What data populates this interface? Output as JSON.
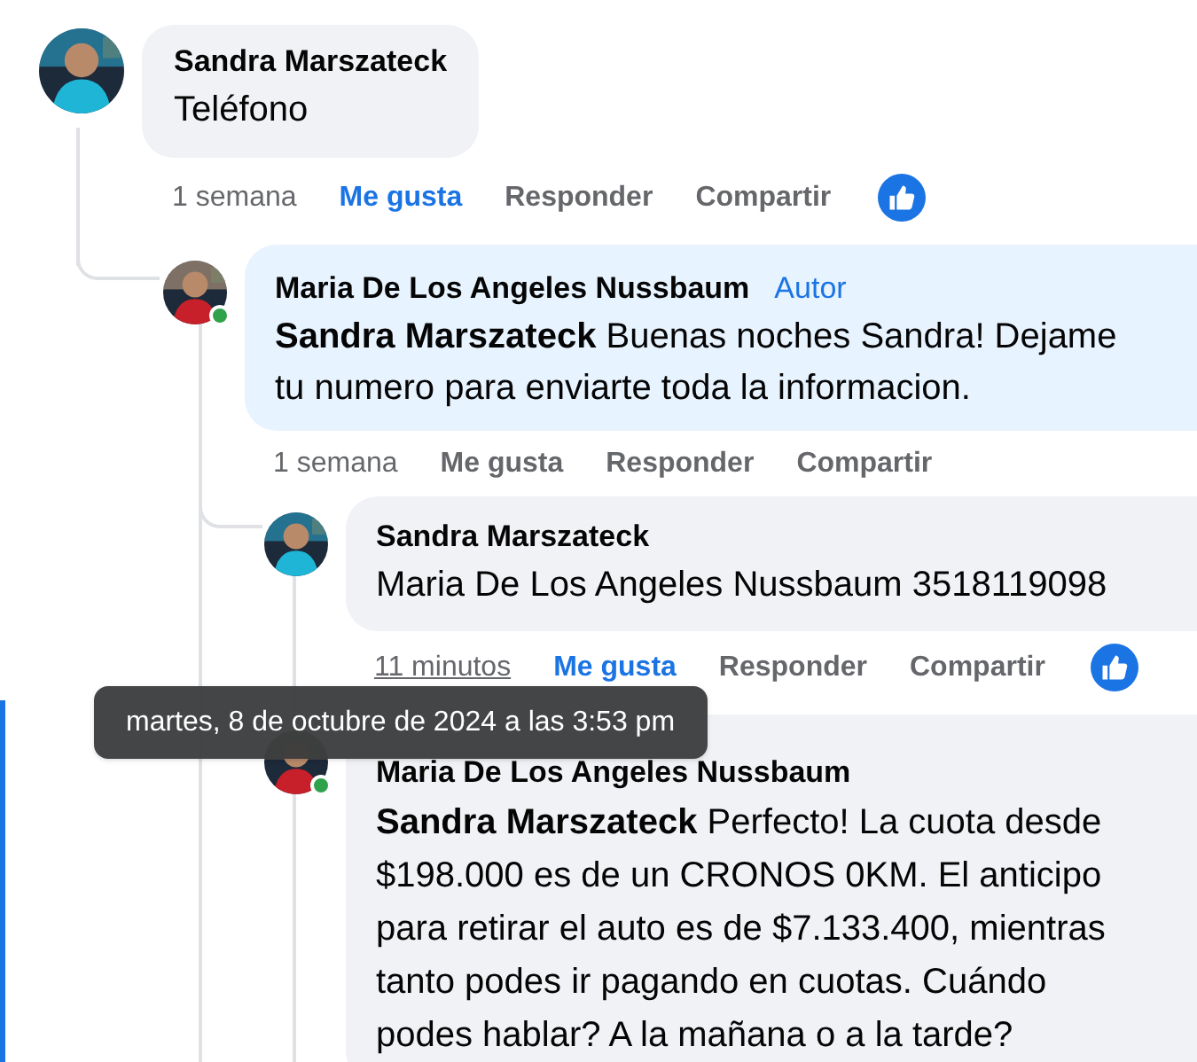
{
  "comments": [
    {
      "author": "Sandra Marszateck",
      "text": "Teléfono",
      "online": false,
      "time": "1 semana",
      "time_hovered": false,
      "like": "Me gusta",
      "liked": true,
      "reply": "Responder",
      "share": "Compartir",
      "reaction": true
    },
    {
      "author": "Maria De Los Angeles Nussbaum",
      "badge": "Autor",
      "text": "**Sandra Marszateck** Buenas noches Sandra! Dejame tu numero para enviarte toda la informacion.",
      "online": true,
      "time": "1 semana",
      "time_hovered": false,
      "like": "Me gusta",
      "liked": false,
      "reply": "Responder",
      "share": "Compartir",
      "reaction": false
    },
    {
      "author": "Sandra Marszateck",
      "text": "Maria De Los Angeles Nussbaum 3518119098",
      "online": false,
      "time": "11 minutos",
      "time_hovered": true,
      "like": "Me gusta",
      "liked": true,
      "reply": "Responder",
      "share": "Compartir",
      "reaction": true
    },
    {
      "author": "Maria De Los Angeles Nussbaum",
      "text": "**Sandra Marszateck** Perfecto! La cuota desde $198.000 es de un CRONOS 0KM. El anticipo para retirar el auto es de $7.133.400, mientras tanto podes ir pagando en cuotas. Cuándo podes hablar? A la mañana o a la tarde?",
      "online": true
    }
  ],
  "tooltip": "martes, 8 de octubre de 2024 a las 3:53 pm"
}
